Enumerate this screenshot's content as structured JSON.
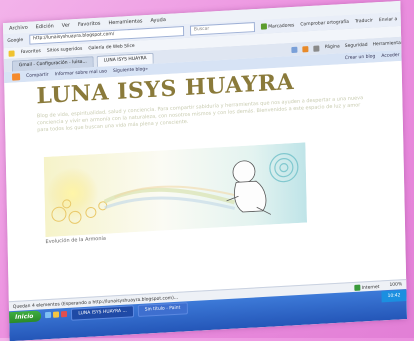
{
  "menubar": {
    "items": [
      "Archivo",
      "Edición",
      "Ver",
      "Favoritos",
      "Herramientas",
      "Ayuda"
    ]
  },
  "addressbar": {
    "search_label": "Google",
    "url": "http://lunaisyshuayra.blogspot.com/",
    "search_placeholder": "Buscar",
    "toolbar_chips": [
      "Marcadores",
      "Comprobar ortografía",
      "Traducir",
      "Enviar a",
      "Configuración"
    ]
  },
  "favbar": {
    "favorites_label": "Favoritos",
    "items": [
      "Sitios sugeridos",
      "Galería de Web Slice"
    ]
  },
  "tabs": {
    "items": [
      "Gmail - Configuración - luisa...",
      "LUNA ISYS HUAYRA"
    ],
    "active_index": 1,
    "tools": [
      "Página",
      "Seguridad",
      "Herramientas"
    ]
  },
  "bloggerbar": {
    "items": [
      "Compartir",
      "Informar sobre mal uso",
      "Siguiente blog»"
    ],
    "right_items": [
      "Crear un blog",
      "Acceder"
    ]
  },
  "blog": {
    "title": "LUNA ISYS HUAYRA",
    "description": "Blog de vida, espiritualidad, salud y conciencia. Para compartir sabiduría y herramientas que nos ayuden a despertar a una nueva conciencia y vivir en armonía con la naturaleza, con nosotros mismos y con los demás. Bienvenidos a este espacio de luz y amor para todos los que buscan una vida más plena y consciente.",
    "header_caption": "Evolución de la Armonía"
  },
  "statusbar": {
    "left": "Quedan 4 elementos (Esperando a http://lunaisyshuayra.blogspot.com)...",
    "zone": "Internet",
    "zoom": "100%"
  },
  "taskbar": {
    "start_label": "Inicio",
    "buttons": [
      "LUNA ISYS HUAYRA ...",
      "Sin título - Paint"
    ],
    "active_index": 0,
    "tray": "10:42"
  },
  "colors": {
    "background_pink": "#ec92e0",
    "title_olive": "#8a7a3a",
    "taskbar_blue": "#2456b8",
    "start_green": "#2a8a2a"
  }
}
